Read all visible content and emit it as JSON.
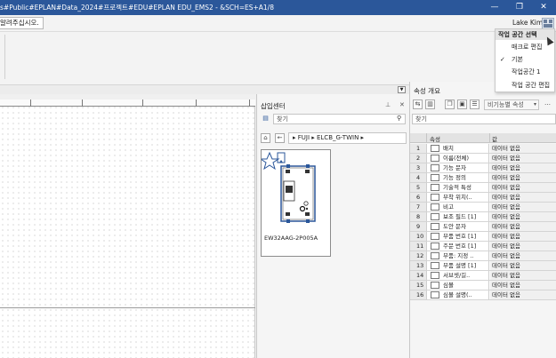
{
  "titlebar": {
    "title": "s#Public#EPLAN#Data_2024#프로젝트#EDU#EPLAN EDU_EMS2 - &SCH=ES+A1/8",
    "user": "Lake Kim",
    "minimize": "—",
    "restore": "❐",
    "close": "✕"
  },
  "ribbon": {
    "search_hint": "알려주십시오."
  },
  "workspace_menu": {
    "header": "작업 공간 선택",
    "items": [
      "매크로 편집",
      "기본",
      "작업공간 1",
      "작업 공간 편집"
    ],
    "checked_item": "기본",
    "check_mark": "✓"
  },
  "insert_center": {
    "title": "삽입센터",
    "search_placeholder": "찾기",
    "breadcrumb": "▸  FUJI  ▸  ELCB_G-TWIN  ▸",
    "card_caption": "EW32AAG-2P005A"
  },
  "properties": {
    "title": "속성 개요",
    "search_placeholder": "찾기",
    "filter_label": "비기능별 속성",
    "col_property": "속성",
    "col_value": "값",
    "rows": [
      {
        "num": "1",
        "name": "배치",
        "value": "데이터 없음"
      },
      {
        "num": "2",
        "name": "이름(전체)",
        "value": "데이터 없음"
      },
      {
        "num": "3",
        "name": "기능 문자",
        "value": "데이터 없음"
      },
      {
        "num": "4",
        "name": "기능 정의",
        "value": "데이터 없음"
      },
      {
        "num": "5",
        "name": "기술적 특성",
        "value": "데이터 없음"
      },
      {
        "num": "6",
        "name": "부착 위치(..",
        "value": "데이터 없음"
      },
      {
        "num": "7",
        "name": "비고",
        "value": "데이터 없음"
      },
      {
        "num": "8",
        "name": "보조 필드 [1]",
        "value": "데이터 없음"
      },
      {
        "num": "9",
        "name": "도안 문자",
        "value": "데이터 없음"
      },
      {
        "num": "10",
        "name": "부품 번호 [1]",
        "value": "데이터 없음"
      },
      {
        "num": "11",
        "name": "주문 번호 [1]",
        "value": "데이터 없음"
      },
      {
        "num": "12",
        "name": "부품: 지정 ..",
        "value": "데이터 없음"
      },
      {
        "num": "13",
        "name": "부품 설명 [1]",
        "value": "데이터 없음"
      },
      {
        "num": "14",
        "name": "서브셋/길..",
        "value": "데이터 없음"
      },
      {
        "num": "15",
        "name": "심볼",
        "value": "데이터 없음"
      },
      {
        "num": "16",
        "name": "심볼 설명(..",
        "value": "데이터 없음"
      }
    ]
  },
  "colors": {
    "titlebar": "#2b579a",
    "accent": "#1f4e96"
  }
}
